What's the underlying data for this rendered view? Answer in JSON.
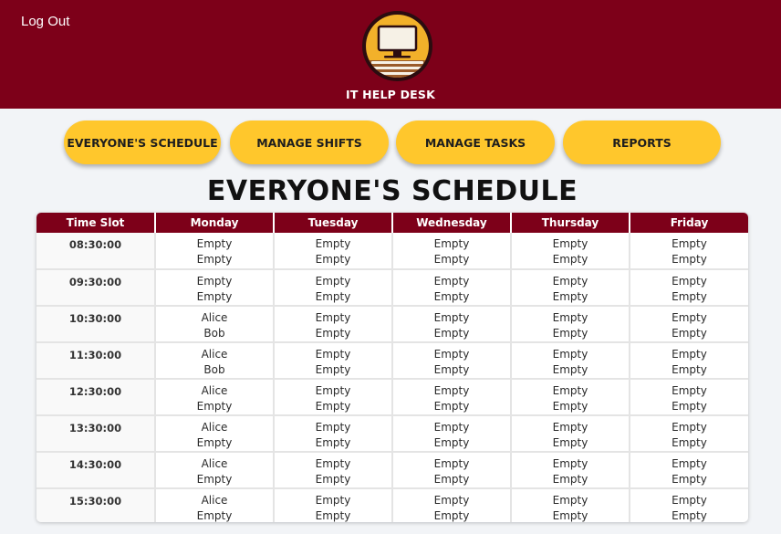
{
  "header": {
    "logout_label": "Log Out",
    "brand": "IT HELP DESK",
    "logo_icon": "computer-monitor-icon",
    "colors": {
      "maroon": "#7d0019",
      "gold": "#ffc72c"
    }
  },
  "nav": [
    {
      "label": "EVERYONE'S SCHEDULE"
    },
    {
      "label": "MANAGE SHIFTS"
    },
    {
      "label": "MANAGE TASKS"
    },
    {
      "label": "REPORTS"
    }
  ],
  "page_title": "EVERYONE'S SCHEDULE",
  "schedule": {
    "columns": [
      "Time Slot",
      "Monday",
      "Tuesday",
      "Wednesday",
      "Thursday",
      "Friday"
    ],
    "rows": [
      {
        "time": "08:30:00",
        "days": [
          [
            "Empty",
            "Empty"
          ],
          [
            "Empty",
            "Empty"
          ],
          [
            "Empty",
            "Empty"
          ],
          [
            "Empty",
            "Empty"
          ],
          [
            "Empty",
            "Empty"
          ]
        ]
      },
      {
        "time": "09:30:00",
        "days": [
          [
            "Empty",
            "Empty"
          ],
          [
            "Empty",
            "Empty"
          ],
          [
            "Empty",
            "Empty"
          ],
          [
            "Empty",
            "Empty"
          ],
          [
            "Empty",
            "Empty"
          ]
        ]
      },
      {
        "time": "10:30:00",
        "days": [
          [
            "Alice",
            "Bob"
          ],
          [
            "Empty",
            "Empty"
          ],
          [
            "Empty",
            "Empty"
          ],
          [
            "Empty",
            "Empty"
          ],
          [
            "Empty",
            "Empty"
          ]
        ]
      },
      {
        "time": "11:30:00",
        "days": [
          [
            "Alice",
            "Bob"
          ],
          [
            "Empty",
            "Empty"
          ],
          [
            "Empty",
            "Empty"
          ],
          [
            "Empty",
            "Empty"
          ],
          [
            "Empty",
            "Empty"
          ]
        ]
      },
      {
        "time": "12:30:00",
        "days": [
          [
            "Alice",
            "Empty"
          ],
          [
            "Empty",
            "Empty"
          ],
          [
            "Empty",
            "Empty"
          ],
          [
            "Empty",
            "Empty"
          ],
          [
            "Empty",
            "Empty"
          ]
        ]
      },
      {
        "time": "13:30:00",
        "days": [
          [
            "Alice",
            "Empty"
          ],
          [
            "Empty",
            "Empty"
          ],
          [
            "Empty",
            "Empty"
          ],
          [
            "Empty",
            "Empty"
          ],
          [
            "Empty",
            "Empty"
          ]
        ]
      },
      {
        "time": "14:30:00",
        "days": [
          [
            "Alice",
            "Empty"
          ],
          [
            "Empty",
            "Empty"
          ],
          [
            "Empty",
            "Empty"
          ],
          [
            "Empty",
            "Empty"
          ],
          [
            "Empty",
            "Empty"
          ]
        ]
      },
      {
        "time": "15:30:00",
        "days": [
          [
            "Alice",
            "Empty"
          ],
          [
            "Empty",
            "Empty"
          ],
          [
            "Empty",
            "Empty"
          ],
          [
            "Empty",
            "Empty"
          ],
          [
            "Empty",
            "Empty"
          ]
        ]
      }
    ]
  }
}
